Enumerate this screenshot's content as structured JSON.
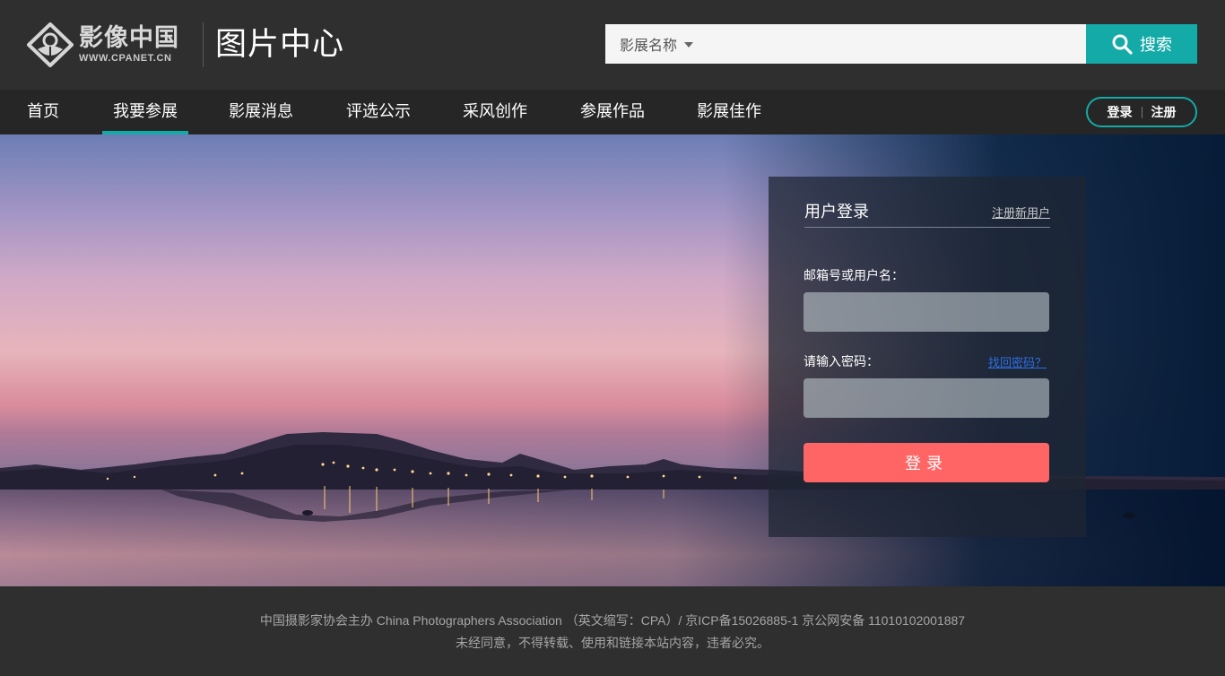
{
  "header": {
    "logo": {
      "cn": "影像中国",
      "en": "WWW.CPANET.CN"
    },
    "site_title": "图片中心",
    "search": {
      "category": "影展名称",
      "button_label": "搜索",
      "value": ""
    }
  },
  "nav": {
    "items": [
      {
        "label": "首页"
      },
      {
        "label": "我要参展",
        "active": true
      },
      {
        "label": "影展消息"
      },
      {
        "label": "评选公示"
      },
      {
        "label": "采风创作"
      },
      {
        "label": "参展作品"
      },
      {
        "label": "影展佳作"
      }
    ],
    "login_label": "登录",
    "register_label": "注册"
  },
  "login": {
    "title": "用户登录",
    "register_link": "注册新用户",
    "username_label": "邮箱号或用户名：",
    "username_value": "",
    "password_label": "请输入密码：",
    "password_value": "",
    "forgot_link": "找回密码？",
    "submit_label": "登录"
  },
  "footer": {
    "line1": "中国摄影家协会主办 China Photographers Association （英文缩写：CPA）/ 京ICP备15026885-1 京公网安备 11010102001887",
    "line2": "未经同意，不得转载、使用和链接本站内容，违者必究。"
  },
  "colors": {
    "accent": "#14aaa8",
    "login_button": "#ff6565",
    "header_bg": "#2f2f2f",
    "nav_bg": "#262626"
  }
}
